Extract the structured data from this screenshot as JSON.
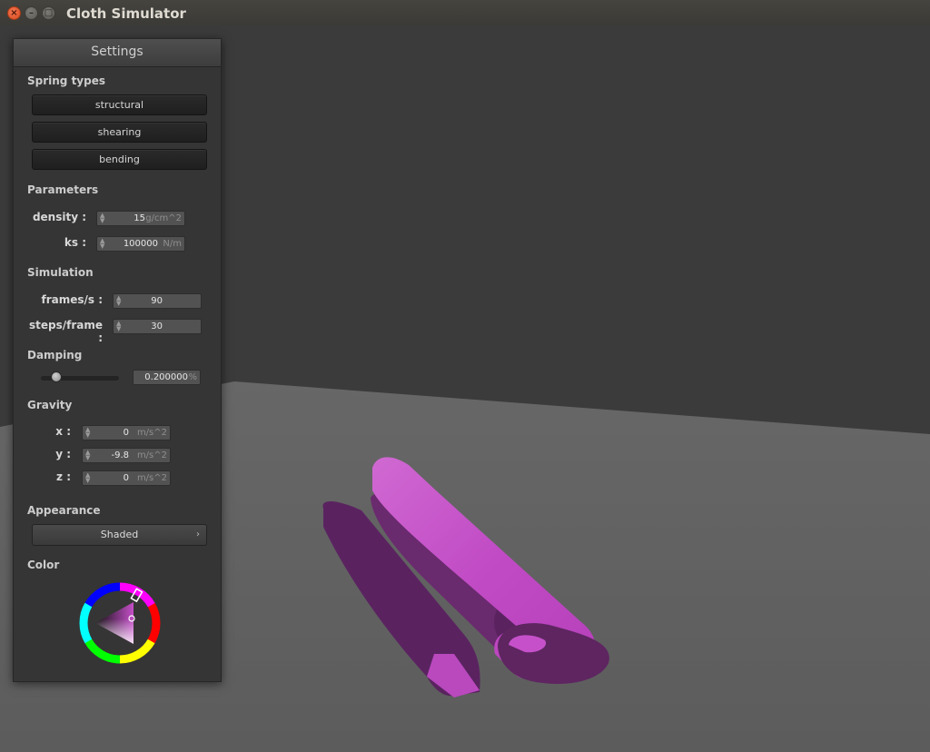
{
  "window": {
    "title": "Cloth Simulator"
  },
  "panel": {
    "title": "Settings",
    "spring_types": {
      "heading": "Spring types",
      "buttons": [
        "structural",
        "shearing",
        "bending"
      ]
    },
    "parameters": {
      "heading": "Parameters",
      "density": {
        "label": "density :",
        "value": "15",
        "unit": "g/cm^2"
      },
      "ks": {
        "label": "ks :",
        "value": "100000",
        "unit": "N/m"
      }
    },
    "simulation": {
      "heading": "Simulation",
      "fps": {
        "label": "frames/s :",
        "value": "90"
      },
      "steps": {
        "label": "steps/frame :",
        "value": "30"
      }
    },
    "damping": {
      "heading": "Damping",
      "value": "0.200000",
      "unit": "%",
      "slider_level": 0.2
    },
    "gravity": {
      "heading": "Gravity",
      "x": {
        "label": "x :",
        "value": "0",
        "unit": "m/s^2"
      },
      "y": {
        "label": "y :",
        "value": "-9.8",
        "unit": "m/s^2"
      },
      "z": {
        "label": "z :",
        "value": "0",
        "unit": "m/s^2"
      }
    },
    "appearance": {
      "heading": "Appearance",
      "selected": "Shaded"
    },
    "color": {
      "heading": "Color",
      "value": "#c44fc8"
    }
  },
  "scene": {
    "background_color": "#3a3a3a",
    "floor_color": "#606060",
    "cloth_color": "#c44fc8",
    "cloth_shadow_color": "#5e2561"
  },
  "icons": {
    "close": "close-icon",
    "minimize": "minimize-icon",
    "maximize": "maximize-icon",
    "spin": "spinner-arrows-icon",
    "chevron": "chevron-right-icon"
  }
}
